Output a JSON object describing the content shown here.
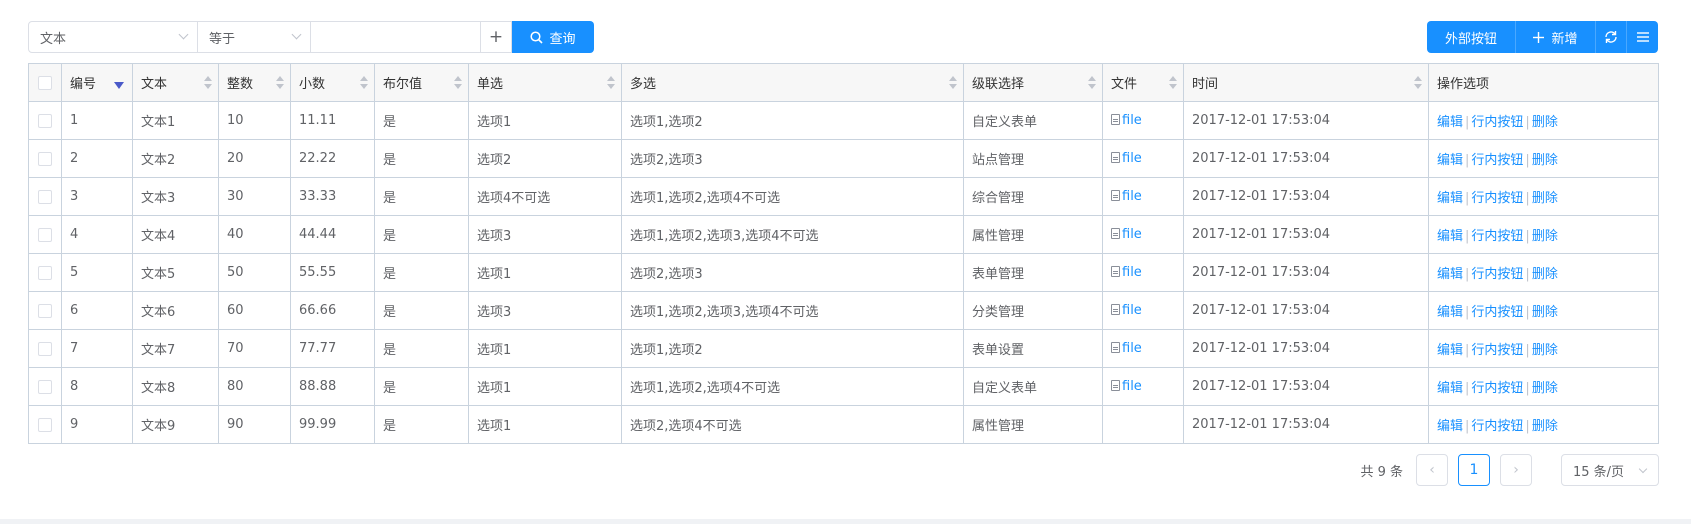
{
  "toolbar": {
    "field_select": "文本",
    "operator_select": "等于",
    "search_value": "",
    "add_condition": "+",
    "query_label": "查询",
    "external_button": "外部按钮",
    "add_button": "新增"
  },
  "columns": [
    "编号",
    "文本",
    "整数",
    "小数",
    "布尔值",
    "单选",
    "多选",
    "级联选择",
    "文件",
    "时间",
    "操作选项"
  ],
  "rows": [
    {
      "id": "1",
      "text": "文本1",
      "int": "10",
      "dec": "11.11",
      "bool": "是",
      "single": "选项1",
      "multi": "选项1,选项2",
      "cascade": "自定义表单",
      "file": "file",
      "time": "2017-12-01 17:53:04"
    },
    {
      "id": "2",
      "text": "文本2",
      "int": "20",
      "dec": "22.22",
      "bool": "是",
      "single": "选项2",
      "multi": "选项2,选项3",
      "cascade": "站点管理",
      "file": "file",
      "time": "2017-12-01 17:53:04"
    },
    {
      "id": "3",
      "text": "文本3",
      "int": "30",
      "dec": "33.33",
      "bool": "是",
      "single": "选项4不可选",
      "multi": "选项1,选项2,选项4不可选",
      "cascade": "综合管理",
      "file": "file",
      "time": "2017-12-01 17:53:04"
    },
    {
      "id": "4",
      "text": "文本4",
      "int": "40",
      "dec": "44.44",
      "bool": "是",
      "single": "选项3",
      "multi": "选项1,选项2,选项3,选项4不可选",
      "cascade": "属性管理",
      "file": "file",
      "time": "2017-12-01 17:53:04"
    },
    {
      "id": "5",
      "text": "文本5",
      "int": "50",
      "dec": "55.55",
      "bool": "是",
      "single": "选项1",
      "multi": "选项2,选项3",
      "cascade": "表单管理",
      "file": "file",
      "time": "2017-12-01 17:53:04"
    },
    {
      "id": "6",
      "text": "文本6",
      "int": "60",
      "dec": "66.66",
      "bool": "是",
      "single": "选项3",
      "multi": "选项1,选项2,选项3,选项4不可选",
      "cascade": "分类管理",
      "file": "file",
      "time": "2017-12-01 17:53:04"
    },
    {
      "id": "7",
      "text": "文本7",
      "int": "70",
      "dec": "77.77",
      "bool": "是",
      "single": "选项1",
      "multi": "选项1,选项2",
      "cascade": "表单设置",
      "file": "file",
      "time": "2017-12-01 17:53:04"
    },
    {
      "id": "8",
      "text": "文本8",
      "int": "80",
      "dec": "88.88",
      "bool": "是",
      "single": "选项1",
      "multi": "选项1,选项2,选项4不可选",
      "cascade": "自定义表单",
      "file": "file",
      "time": "2017-12-01 17:53:04"
    },
    {
      "id": "9",
      "text": "文本9",
      "int": "90",
      "dec": "99.99",
      "bool": "是",
      "single": "选项1",
      "multi": "选项2,选项4不可选",
      "cascade": "属性管理",
      "file": "",
      "time": "2017-12-01 17:53:04"
    }
  ],
  "actions": {
    "edit": "编辑",
    "inline": "行内按钮",
    "delete": "删除",
    "separator": "|"
  },
  "pagination": {
    "total": "共 9 条",
    "current_page": "1",
    "page_size": "15 条/页"
  },
  "colors": {
    "primary": "#1890ff",
    "border": "#c9d3de",
    "header_bg": "#f7f7f7",
    "sort_active": "#4a5ac9"
  }
}
